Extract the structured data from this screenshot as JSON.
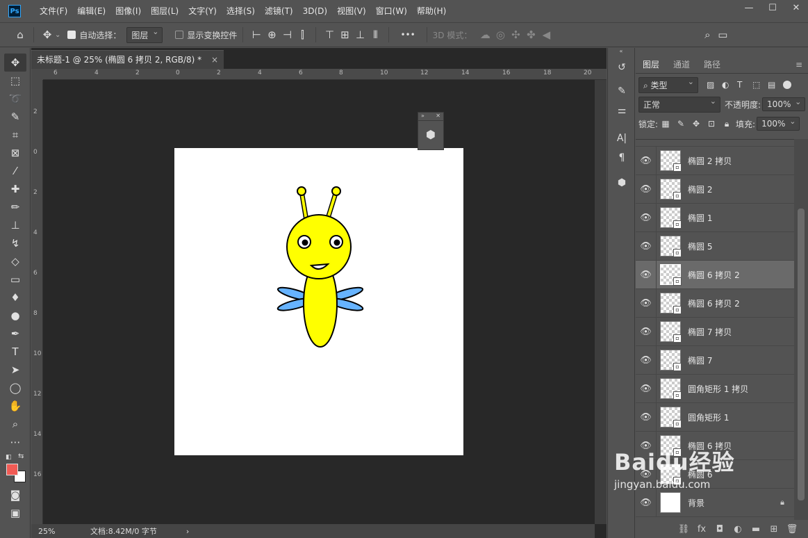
{
  "app": {
    "logo": "Ps",
    "menu": [
      "文件(F)",
      "编辑(E)",
      "图像(I)",
      "图层(L)",
      "文字(Y)",
      "选择(S)",
      "滤镜(T)",
      "3D(D)",
      "视图(V)",
      "窗口(W)",
      "帮助(H)"
    ],
    "win": [
      "—",
      "☐",
      "✕"
    ]
  },
  "options": {
    "auto_select_label": "自动选择：",
    "auto_select_value": "图层",
    "show_transform": "显示变换控件",
    "mode_3d": "3D 模式：",
    "more": "•••"
  },
  "document": {
    "tab_title": "未标题-1 @ 25% (椭圆 6 拷贝 2, RGB/8) *",
    "tab_close": "×",
    "zoom": "25%",
    "doc_info": "文档:8.42M/0 字节",
    "arrow": "›",
    "ruler_h": [
      "6",
      "4",
      "2",
      "0",
      "2",
      "4",
      "6",
      "8",
      "10",
      "12",
      "14",
      "16",
      "18",
      "20"
    ],
    "ruler_v": [
      "2",
      "0",
      "2",
      "4",
      "6",
      "8",
      "10",
      "12",
      "14",
      "16"
    ]
  },
  "layers_panel": {
    "tabs": [
      "图层",
      "通道",
      "路径"
    ],
    "filter": "类型",
    "blend": "正常",
    "opacity_label": "不透明度:",
    "opacity": "100%",
    "lock_label": "锁定:",
    "fill_label": "填充:",
    "fill": "100%",
    "layers": [
      {
        "name": "椭圆 2 拷贝",
        "selected": false
      },
      {
        "name": "椭圆 2",
        "selected": false
      },
      {
        "name": "椭圆 1",
        "selected": false
      },
      {
        "name": "椭圆 5",
        "selected": false
      },
      {
        "name": "椭圆 6 拷贝 2",
        "selected": true
      },
      {
        "name": "椭圆 6 拷贝 2",
        "selected": false
      },
      {
        "name": "椭圆 7 拷贝",
        "selected": false
      },
      {
        "name": "椭圆 7",
        "selected": false
      },
      {
        "name": "圆角矩形 1 拷贝",
        "selected": false
      },
      {
        "name": "圆角矩形 1",
        "selected": false
      },
      {
        "name": "椭圆 6 拷贝",
        "selected": false
      },
      {
        "name": "椭圆 6",
        "selected": false
      },
      {
        "name": "背景",
        "selected": false
      }
    ]
  },
  "colors": {
    "fg": "#f15b55",
    "bg": "#ffffff",
    "bee_yellow": "#ffff00",
    "wing_blue": "#66b3ff"
  },
  "watermark": {
    "line1": "Baidu经验",
    "line2": "jingyan.baidu.com"
  }
}
